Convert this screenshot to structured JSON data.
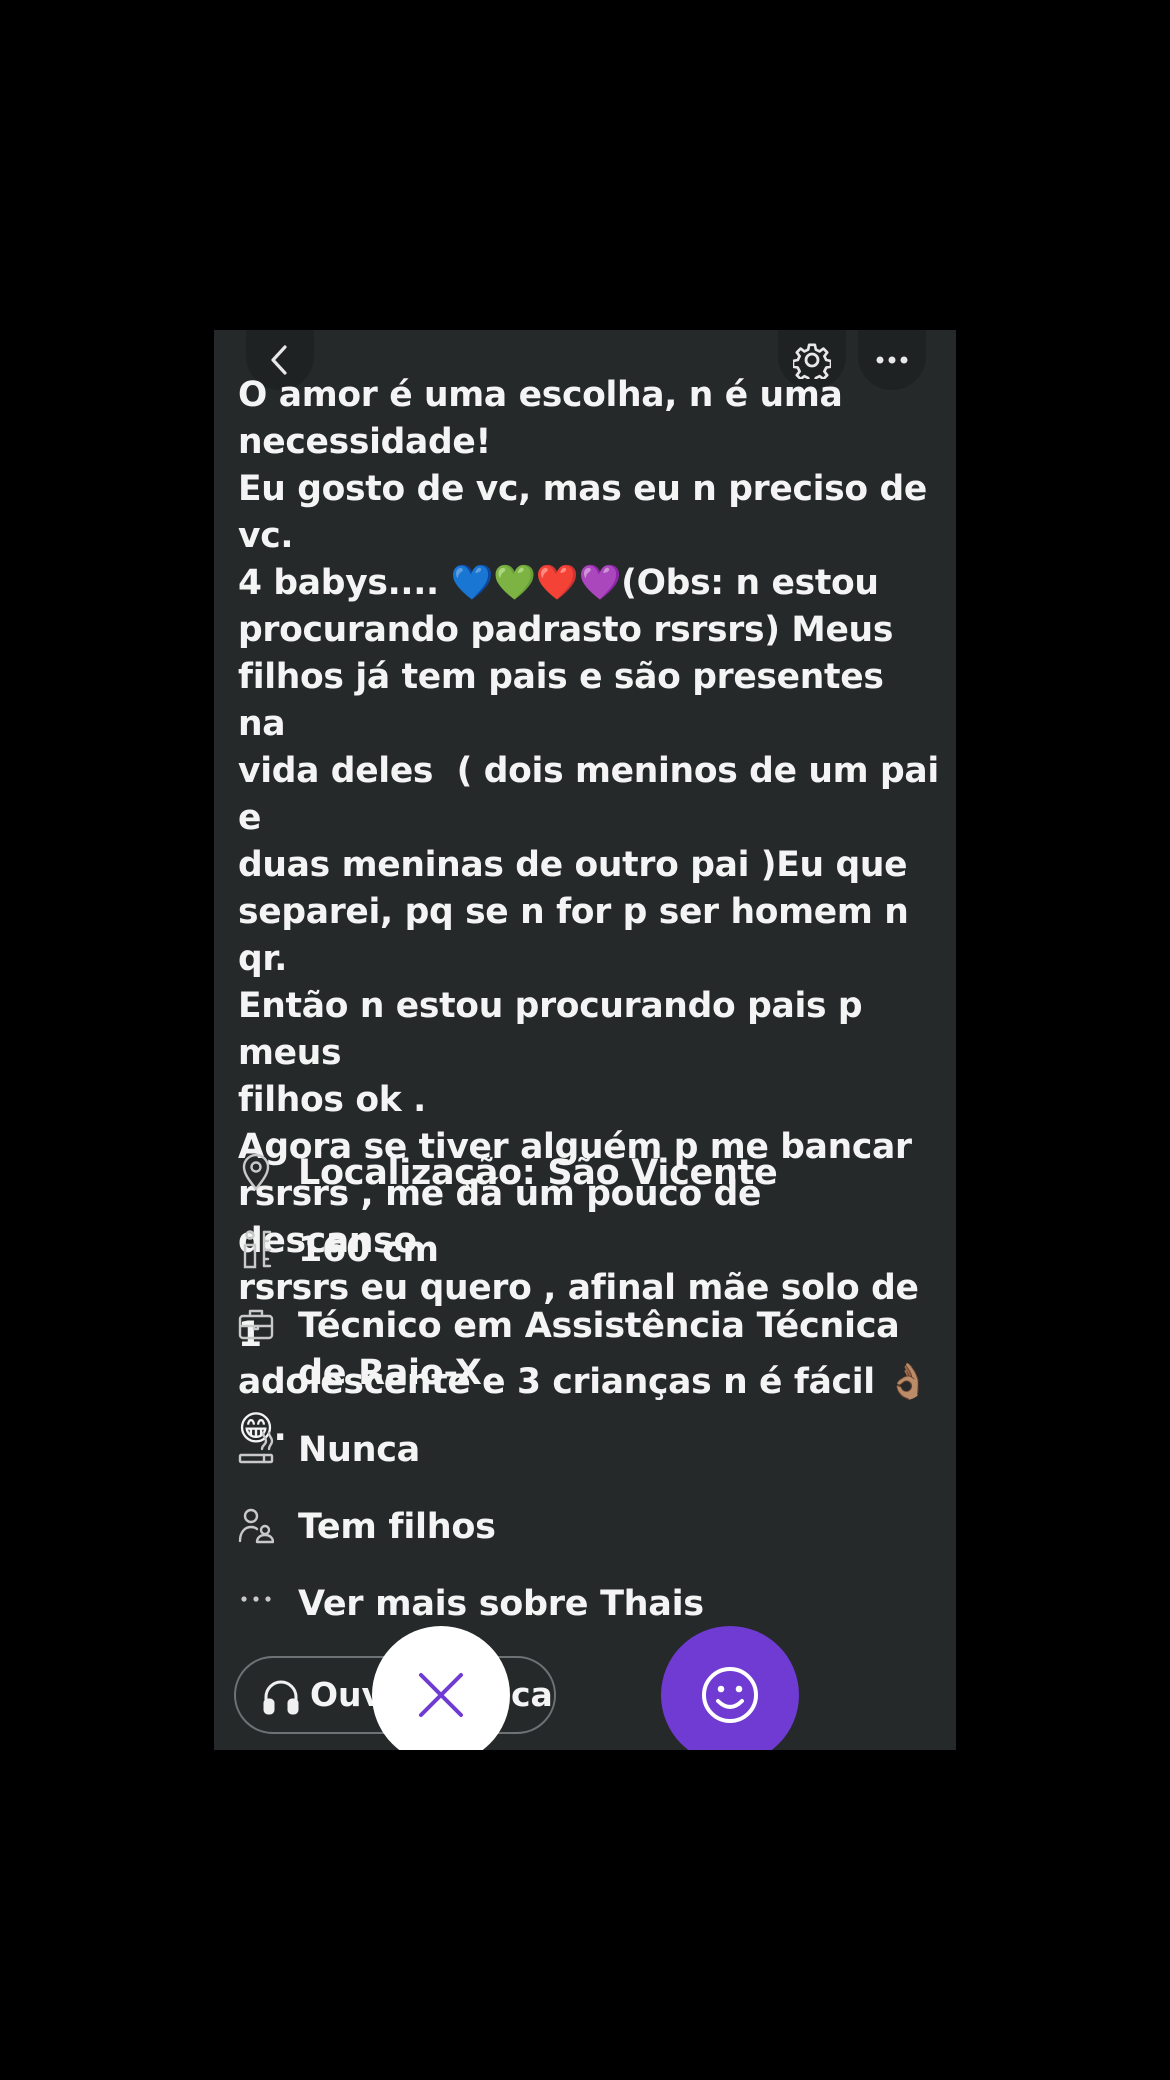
{
  "header": {
    "back_icon": "chevron-left-icon",
    "settings_icon": "gear-icon",
    "more_icon": "more-dots-icon"
  },
  "bio": {
    "text": "O amor é uma escolha, n é uma\nnecessidade!\nEu gosto de vc, mas eu n preciso de vc.\n4 babys.... 💙💚❤️💜(Obs: n estou\nprocurando padrasto rsrsrs) Meus\nfilhos já tem pais e são presentes na\nvida deles  ( dois meninos de um pai e\nduas meninas de outro pai )Eu que\nseparei, pq se n for p ser homem n qr.\nEntão n estou procurando pais p meus\nfilhos ok .\nAgora se tiver alguém p me bancar\nrsrsrs , me dá um pouco de descanso\nrsrsrs eu quero , afinal mãe solo de 1\nadolescente e 3 crianças n é fácil 👌🏽\n😁."
  },
  "details": [
    {
      "icon": "location-pin-icon",
      "text": "Localização: São Vicente"
    },
    {
      "icon": "height-icon",
      "text": "160 cm"
    },
    {
      "icon": "briefcase-icon",
      "text": "Técnico em Assistência Técnica de Raio-X"
    },
    {
      "icon": "smoking-icon",
      "text": "Nunca"
    },
    {
      "icon": "children-icon",
      "text": "Tem filhos"
    },
    {
      "icon": "more-dots-icon",
      "text": "Ver mais sobre Thais"
    }
  ],
  "actions": {
    "listen_label": "Ouvir música",
    "listen_icon": "headphones-icon",
    "pass_icon": "close-icon",
    "like_icon": "smiley-icon",
    "pass_color": "#6f3bd2",
    "like_color": "#6f3bd2"
  }
}
